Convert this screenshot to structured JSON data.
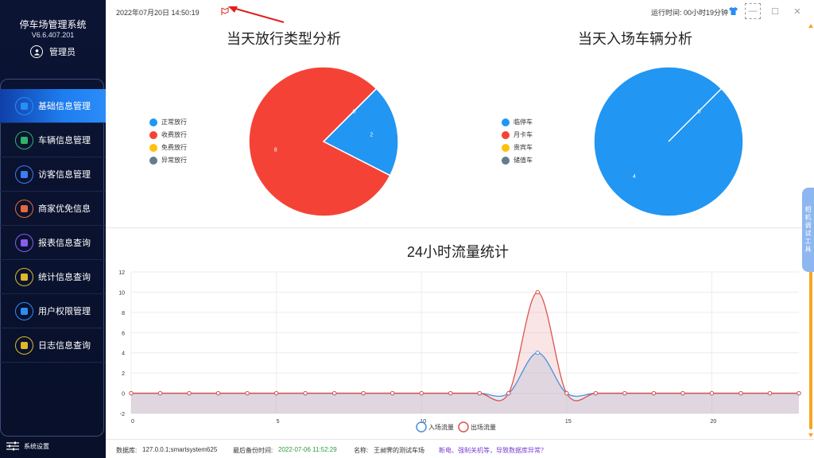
{
  "sidebar": {
    "title": "停车场管理系统",
    "version": "V6.6.407.201",
    "user": "管理员",
    "settings_label": "系统设置",
    "items": [
      {
        "label": "基础信息管理",
        "color": "#2a8df5",
        "icon": "gear-icon"
      },
      {
        "label": "车辆信息管理",
        "color": "#2fb36b",
        "icon": "car-icon"
      },
      {
        "label": "访客信息管理",
        "color": "#3b7ef0",
        "icon": "visitor-icon"
      },
      {
        "label": "商家优免信息",
        "color": "#e8683a",
        "icon": "cart-icon"
      },
      {
        "label": "报表信息查询",
        "color": "#8a5cf0",
        "icon": "report-icon"
      },
      {
        "label": "统计信息查询",
        "color": "#e0b82a",
        "icon": "stats-icon"
      },
      {
        "label": "用户权限管理",
        "color": "#2a8df5",
        "icon": "users-icon"
      },
      {
        "label": "日志信息查询",
        "color": "#e0b82a",
        "icon": "log-icon"
      }
    ]
  },
  "topbar": {
    "datetime": "2022年07月20日 14:50:19",
    "runtime": "运行时间: 00小时19分钟",
    "minimize": "—",
    "maximize": "☐",
    "close": "✕"
  },
  "camera_tab": "相机调试工具",
  "status": {
    "db_label": "数据库:",
    "db_value": "127.0.0.1;smartsystem625",
    "backup_label": "最后备份时间:",
    "backup_value": "2022-07-06 11:52:29",
    "name_label": "名称:",
    "name_value": "王昶霁的测试车场",
    "scroll_text": "断电、强制关机等，导致数据库异常？"
  },
  "colors": {
    "blue": "#2196f3",
    "red": "#f44336",
    "yellow": "#ffc107",
    "grey": "#607d8b"
  },
  "chart_data": [
    {
      "type": "pie",
      "title": "当天放行类型分析",
      "legend": [
        "正常放行",
        "收费放行",
        "免费放行",
        "异常放行"
      ],
      "values": [
        2,
        8,
        0,
        0
      ],
      "legend_position": "left"
    },
    {
      "type": "pie",
      "title": "当天入场车辆分析",
      "legend": [
        "临停车",
        "月卡车",
        "贵宾车",
        "储值车"
      ],
      "values": [
        4,
        0,
        0,
        0
      ],
      "legend_position": "left"
    },
    {
      "type": "area",
      "title": "24小时流量统计",
      "x": [
        0,
        1,
        2,
        3,
        4,
        5,
        6,
        7,
        8,
        9,
        10,
        11,
        12,
        13,
        14,
        15,
        16,
        17,
        18,
        19,
        20,
        21,
        22,
        23
      ],
      "series": [
        {
          "name": "入场流量",
          "values": [
            0,
            0,
            0,
            0,
            0,
            0,
            0,
            0,
            0,
            0,
            0,
            0,
            0,
            0,
            4,
            0,
            0,
            0,
            0,
            0,
            0,
            0,
            0,
            0
          ]
        },
        {
          "name": "出场流量",
          "values": [
            0,
            0,
            0,
            0,
            0,
            0,
            0,
            0,
            0,
            0,
            0,
            0,
            0,
            0,
            10,
            0,
            0,
            0,
            0,
            0,
            0,
            0,
            0,
            0
          ]
        }
      ],
      "ylim": [
        -2,
        12
      ],
      "yticks": [
        -2,
        0,
        2,
        4,
        6,
        8,
        10,
        12
      ],
      "xticks": [
        0,
        5,
        10,
        15,
        20
      ],
      "grid": true,
      "legend_position": "bottom"
    }
  ]
}
